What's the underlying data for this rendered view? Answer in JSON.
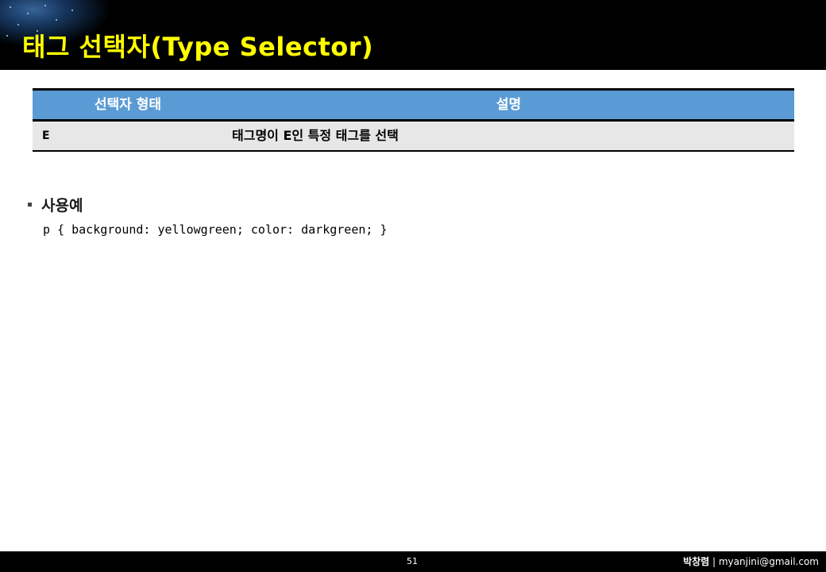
{
  "slide": {
    "title": "태그 선택자(Type Selector)",
    "page_number": "51",
    "author_name": "박창렴",
    "author_separator": " | ",
    "author_email": "myanjini@gmail.com"
  },
  "table": {
    "headers": [
      "선택자 형태",
      "설명"
    ],
    "rows": [
      [
        "E",
        "태그명이 E인 특정 태그를 선택"
      ]
    ]
  },
  "section": {
    "heading": "사용예",
    "code": "p { background: yellowgreen; color: darkgreen; }"
  },
  "colors": {
    "title_text": "#ffff00",
    "title_bar": "#000000",
    "header_fill": "#5b9bd5",
    "row_fill": "#e7e7e7"
  }
}
